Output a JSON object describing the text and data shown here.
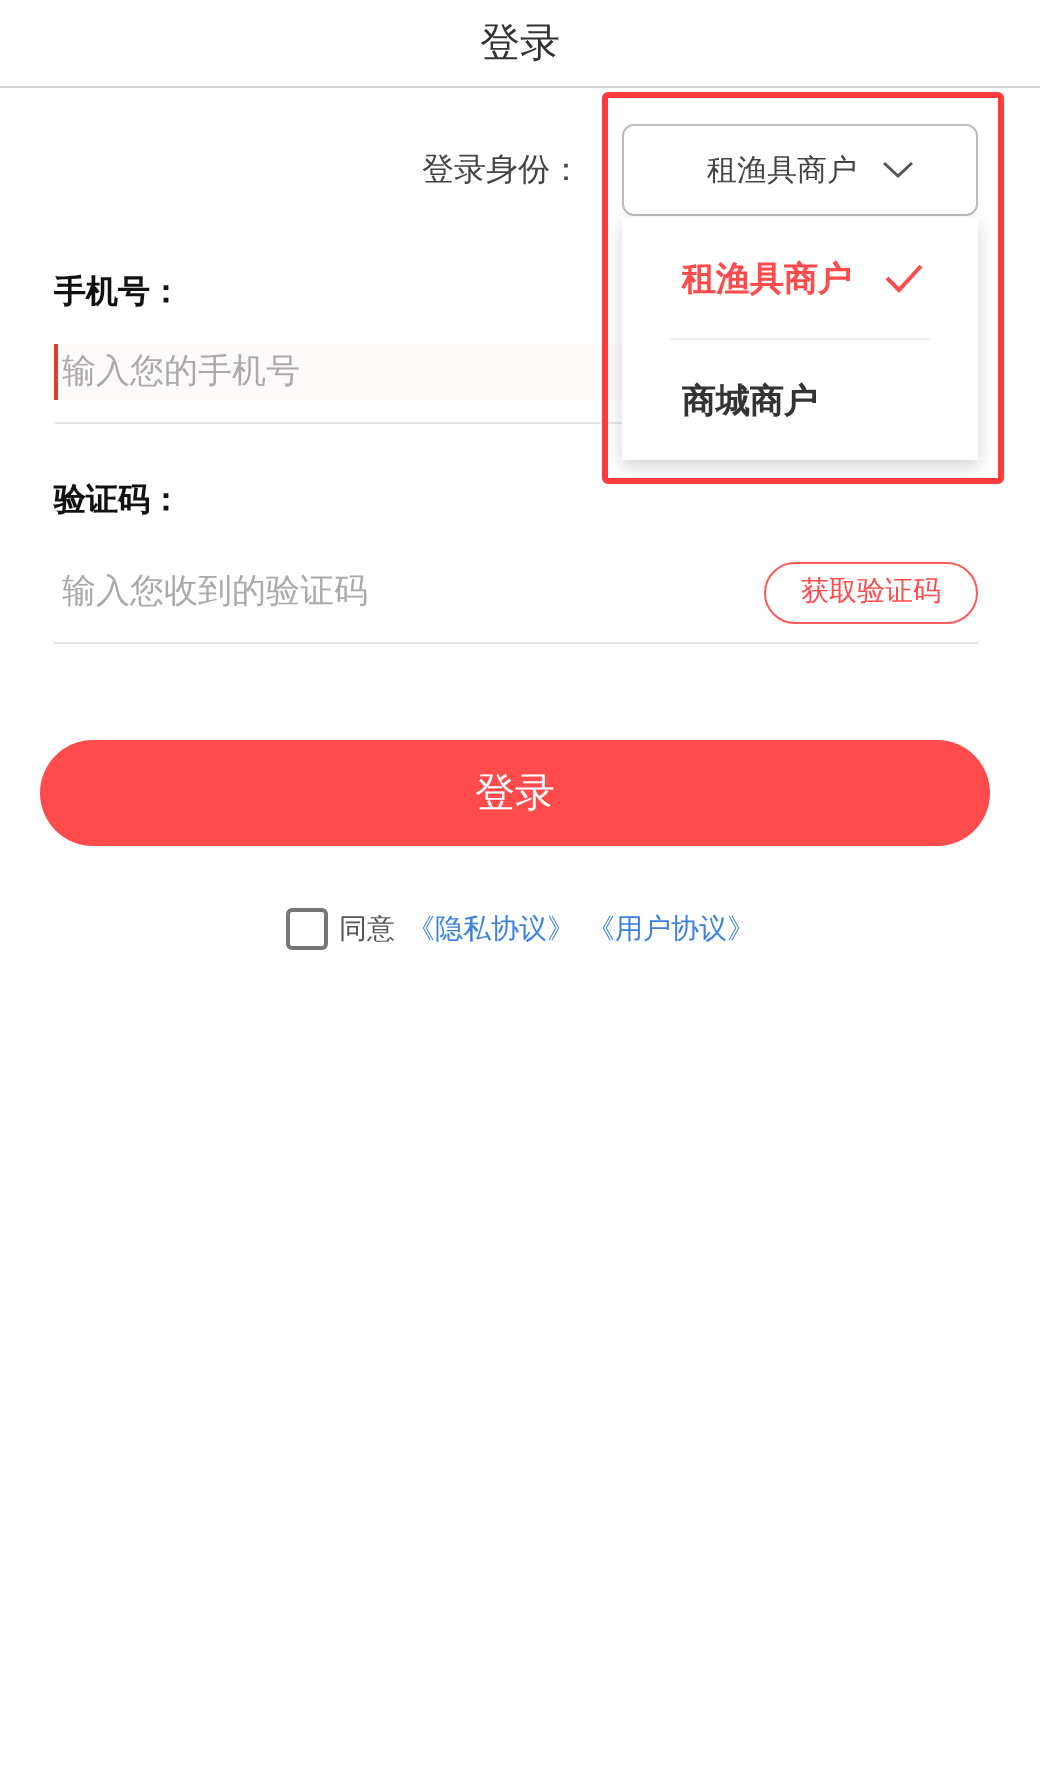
{
  "header": {
    "title": "登录"
  },
  "identity": {
    "label": "登录身份：",
    "value": "租渔具商户",
    "expanded": true,
    "highlight": true,
    "options": [
      {
        "label": "租渔具商户",
        "selected": true
      },
      {
        "label": "商城商户",
        "selected": false
      }
    ]
  },
  "fields": [
    {
      "label": "手机号：",
      "placeholder": "输入您的手机号",
      "focused": true
    },
    {
      "label": "验证码：",
      "placeholder": "输入您收到的验证码",
      "focused": false,
      "action": "获取验证码"
    }
  ],
  "login_button": "登录",
  "agreement": {
    "checked": false,
    "text": "同意",
    "links": [
      "《隐私协议》",
      "《用户协议》"
    ]
  }
}
